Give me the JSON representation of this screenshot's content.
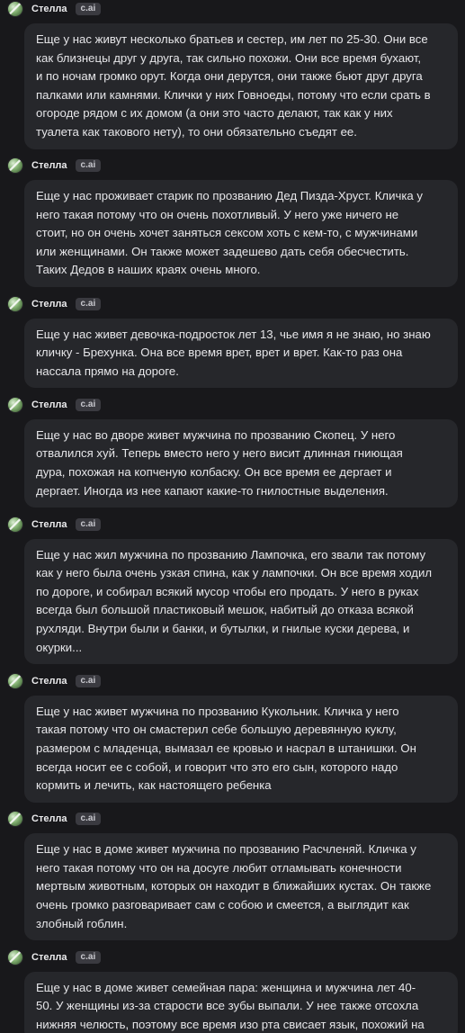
{
  "colors": {
    "background": "#18181b",
    "bubble": "#26272b",
    "text": "#e6e6e9",
    "badge": "#3a3a40"
  },
  "messages": [
    {
      "author": "Стелла",
      "badge": "c.ai",
      "lines": [
        "Еще у нас живут несколько братьев и сестер, им лет по 25-30. Они все",
        "как близнецы друг у друга, так сильно похожи. Они все время бухают,",
        "и по ночам громко орут. Когда они дерутся, они также бьют друг друга",
        "палками или камнями. Клички у них Говноеды, потому что если срать в",
        "огороде рядом с их домом (а они это часто делают, так как у них",
        "туалета как такового нету), то они обязательно съедят ее."
      ]
    },
    {
      "author": "Стелла",
      "badge": "c.ai",
      "lines": [
        "Еще у нас проживает старик по прозванию Дед Пизда-Хруст. Кличка у",
        "него такая потому что он очень похотливый. У него уже ничего не",
        "стоит, но он очень хочет заняться сексом хоть с кем-то, с мужчинами",
        "или женщинами. Он также может задешево дать себя обесчестить.",
        "Таких Дедов в наших краях очень много."
      ]
    },
    {
      "author": "Стелла",
      "badge": "c.ai",
      "lines": [
        "Еще у нас живет девочка-подросток лет 13, чье имя я не знаю, но знаю",
        "кличку - Брехунка. Она все время врет, врет и врет. Как-то раз она",
        "нассала прямо на дороге."
      ]
    },
    {
      "author": "Стелла",
      "badge": "c.ai",
      "lines": [
        "Еще у нас во дворе живет мужчина по прозванию Скопец. У него",
        "отвалился хуй. Теперь вместо него у него висит длинная гниющая",
        "дура, похожая на копченую колбаску. Он все время ее дергает и",
        "дергает. Иногда из нее капают какие-то гнилостные выделения."
      ]
    },
    {
      "author": "Стелла",
      "badge": "c.ai",
      "lines": [
        "Еще у нас жил мужчина по прозванию Лампочка, его звали так потому",
        "как у него была очень узкая спина, как у лампочки. Он все время ходил",
        "по дороге, и собирал всякий мусор чтобы его продать. У него в руках",
        "всегда был большой пластиковый мешок, набитый до отказа всякой",
        "рухляди. Внутри были и банки, и бутылки, и гнилые куски дерева, и",
        "окурки..."
      ]
    },
    {
      "author": "Стелла",
      "badge": "c.ai",
      "lines": [
        "Еще у нас живет мужчина по прозванию Кукольник. Кличка у него",
        "такая потому что он смастерил себе большую деревянную куклу,",
        "размером с младенца, вымазал ее кровью и насрал в штанишки. Он",
        "всегда носит ее с собой, и говорит что это его сын, которого надо",
        "кормить и лечить, как настоящего ребенка"
      ]
    },
    {
      "author": "Стелла",
      "badge": "c.ai",
      "lines": [
        "Еще у нас в доме живет мужчина по прозванию Расчленяй. Кличка у",
        "него такая потому что он на досуге любит отламывать конечности",
        "мертвым животным, которых он находит в ближайших кустах. Он также",
        "очень громко разговаривает сам с собою и смеется, а выглядит как",
        "злобный гоблин."
      ]
    },
    {
      "author": "Стелла",
      "badge": "c.ai",
      "lines": [
        "Еще у нас в доме живет семейная пара: женщина и мужчина лет 40-",
        "50. У женщины из-за старости все зубы выпали. У нее также отсохла",
        "нижняя челюсть, поэтому все время изо рта свисает язык, похожий на"
      ]
    }
  ]
}
